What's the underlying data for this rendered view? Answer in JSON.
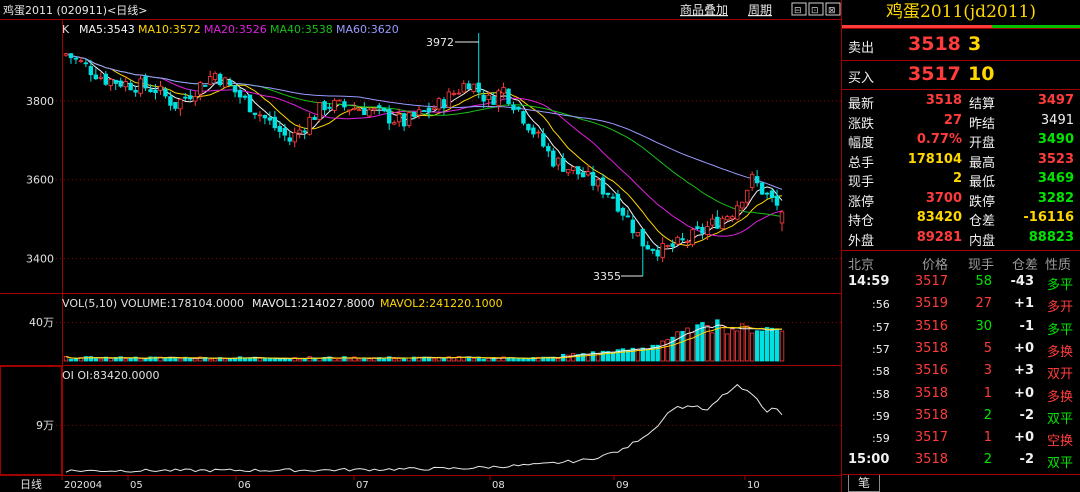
{
  "header": {
    "instrument": "鸡蛋2011 (020911)<日线>",
    "menu": [
      "商品叠加",
      "周期"
    ],
    "window_btns": [
      "⊟",
      "⊡",
      "⊠"
    ]
  },
  "main_chart": {
    "type_label": "K",
    "ma": [
      {
        "label": "MA5:3543",
        "color": "#f5f5f5"
      },
      {
        "label": "MA10:3572",
        "color": "#ffd700"
      },
      {
        "label": "MA20:3526",
        "color": "#e020e0"
      },
      {
        "label": "MA40:3538",
        "color": "#18c018"
      },
      {
        "label": "MA60:3620",
        "color": "#9a9aff"
      }
    ],
    "y_ticks": [
      "3800",
      "3600",
      "3400"
    ],
    "y_values": [
      3800,
      3600,
      3400
    ],
    "ylim": [
      3320,
      4000
    ],
    "high_label": "3972",
    "low_label": "3355"
  },
  "volume": {
    "title": "VOL(5,10) VOLUME:178104.0000",
    "mavol1": "MAVOL1:214027.8000",
    "mavol2": "MAVOL2:241220.1000",
    "tick": "40万"
  },
  "oi": {
    "title": "OI OI:83420.0000",
    "tick": "9万"
  },
  "x_axis": {
    "period": "日线",
    "labels": [
      "202004",
      "05",
      "06",
      "07",
      "08",
      "09",
      "10"
    ]
  },
  "side": {
    "title": "鸡蛋2011(jd2011)",
    "sell": {
      "label": "卖出",
      "price": "3518",
      "vol": "3"
    },
    "buy": {
      "label": "买入",
      "price": "3517",
      "vol": "10"
    },
    "stats": [
      [
        "最新",
        "3518",
        "结算",
        "3497"
      ],
      [
        "涨跌",
        "27",
        "昨结",
        "3491"
      ],
      [
        "幅度",
        "0.77%",
        "开盘",
        "3490"
      ],
      [
        "总手",
        "178104",
        "最高",
        "3523"
      ],
      [
        "现手",
        "2",
        "最低",
        "3469"
      ],
      [
        "涨停",
        "3700",
        "跌停",
        "3282"
      ],
      [
        "持仓",
        "83420",
        "仓差",
        "-16116"
      ],
      [
        "外盘",
        "89281",
        "内盘",
        "88823"
      ]
    ],
    "tick_header": [
      "北京",
      "价格",
      "现手",
      "仓差",
      "性质"
    ],
    "ticks": [
      [
        "14:59",
        "3517",
        "58",
        "-43",
        "多平"
      ],
      [
        ":56",
        "3519",
        "27",
        "+1",
        "多开"
      ],
      [
        ":57",
        "3516",
        "30",
        "-1",
        "多平"
      ],
      [
        ":57",
        "3518",
        "5",
        "+0",
        "多换"
      ],
      [
        ":58",
        "3516",
        "3",
        "+3",
        "双开"
      ],
      [
        ":58",
        "3518",
        "1",
        "+0",
        "多换"
      ],
      [
        ":59",
        "3518",
        "2",
        "-2",
        "双平"
      ],
      [
        ":59",
        "3517",
        "1",
        "+0",
        "空换"
      ],
      [
        "15:00",
        "3518",
        "2",
        "-2",
        "双平"
      ]
    ],
    "footer_tab": "笔"
  },
  "colors": {
    "up": "#ff3c3c",
    "down": "#00e0e0",
    "grid": "#8a0000",
    "border": "#a00000"
  }
}
